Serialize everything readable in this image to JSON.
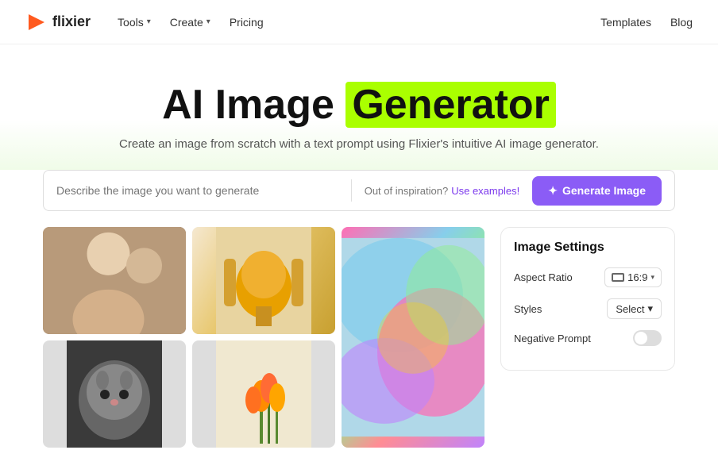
{
  "nav": {
    "logo_text": "flixier",
    "tools_label": "Tools",
    "create_label": "Create",
    "pricing_label": "Pricing",
    "templates_label": "Templates",
    "blog_label": "Blog"
  },
  "hero": {
    "title_part1": "AI Image",
    "title_part2": "Generator",
    "subtitle": "Create an image from scratch with a text prompt using Flixier's intuitive AI image generator."
  },
  "prompt": {
    "placeholder": "Describe the image you want to generate",
    "inspiration_text": "Out of inspiration?",
    "use_examples_label": "Use examples!",
    "generate_button_label": "Generate Image",
    "generate_icon": "✦"
  },
  "image_settings": {
    "title": "Image Settings",
    "aspect_ratio_label": "Aspect Ratio",
    "aspect_ratio_value": "16:9",
    "styles_label": "Styles",
    "styles_value": "Select",
    "negative_prompt_label": "Negative Prompt",
    "negative_prompt_toggle": false
  },
  "gallery": {
    "items": [
      {
        "id": "women",
        "alt": "Two women sitting"
      },
      {
        "id": "chair",
        "alt": "Orange chair"
      },
      {
        "id": "colorful",
        "alt": "Colorful abstract painting",
        "large": true
      },
      {
        "id": "cat",
        "alt": "Cat close up"
      },
      {
        "id": "flowers",
        "alt": "Orange tulips"
      }
    ]
  }
}
